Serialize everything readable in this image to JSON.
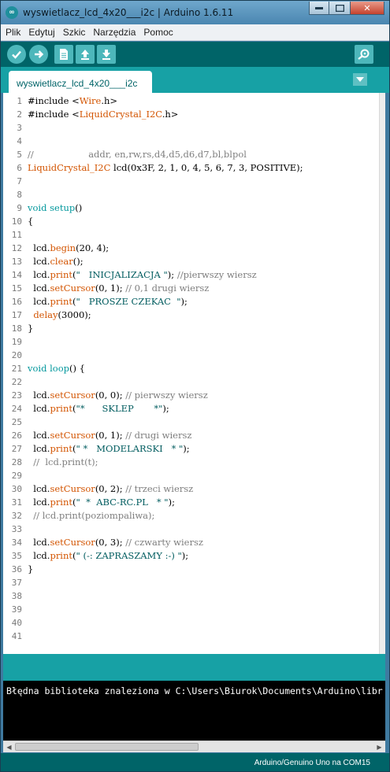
{
  "window": {
    "title": "wyswietlacz_lcd_4x20___i2c | Arduino 1.6.11",
    "app_icon": "arduino-logo-icon",
    "controls": [
      "minimize-icon",
      "maximize-icon",
      "close-icon"
    ]
  },
  "menu": [
    "Plik",
    "Edytuj",
    "Szkic",
    "Narzędzia",
    "Pomoc"
  ],
  "toolbar": {
    "buttons": [
      "verify-icon",
      "upload-icon",
      "new-file-icon",
      "open-file-icon",
      "save-file-icon"
    ],
    "right_button": "serial-monitor-icon"
  },
  "tab": {
    "label": "wyswietlacz_lcd_4x20___i2c",
    "menu_icon": "tab-dropdown-icon"
  },
  "colors": {
    "accent_dark": "#006468",
    "accent": "#17a1a5",
    "keyword": "#00979c",
    "method": "#d35400"
  },
  "code": {
    "line_numbers": [
      "1",
      "2",
      "3",
      "4",
      "5",
      "6",
      "7",
      "8",
      "9",
      "10",
      "11",
      "12",
      "13",
      "14",
      "15",
      "16",
      "17",
      "18",
      "19",
      "20",
      "21",
      "22",
      "23",
      "24",
      "25",
      "26",
      "27",
      "28",
      "29",
      "30",
      "31",
      "32",
      "33",
      "34",
      "35",
      "36",
      "37",
      "38",
      "39",
      "40",
      "41"
    ],
    "lines": [
      [
        {
          "t": "#include <",
          "c": ""
        },
        {
          "t": "Wire",
          "c": "o"
        },
        {
          "t": ".h>",
          "c": ""
        }
      ],
      [
        {
          "t": "#include <",
          "c": ""
        },
        {
          "t": "LiquidCrystal_I2C",
          "c": "o"
        },
        {
          "t": ".h>",
          "c": ""
        }
      ],
      [],
      [],
      [
        {
          "t": "//                   addr, en,rw,rs,d4,d5,d6,d7,bl,blpol",
          "c": "c"
        }
      ],
      [
        {
          "t": "LiquidCrystal_I2C",
          "c": "o"
        },
        {
          "t": " lcd(0x3F, 2, 1, 0, 4, 5, 6, 7, 3, POSITIVE);",
          "c": ""
        }
      ],
      [],
      [],
      [
        {
          "t": "void",
          "c": "k"
        },
        {
          "t": " ",
          "c": ""
        },
        {
          "t": "setup",
          "c": "k"
        },
        {
          "t": "()",
          "c": ""
        }
      ],
      [
        {
          "t": "{",
          "c": ""
        }
      ],
      [],
      [
        {
          "t": "  lcd.",
          "c": ""
        },
        {
          "t": "begin",
          "c": "o"
        },
        {
          "t": "(20, 4);",
          "c": ""
        }
      ],
      [
        {
          "t": "  lcd.",
          "c": ""
        },
        {
          "t": "clear",
          "c": "o"
        },
        {
          "t": "();",
          "c": ""
        }
      ],
      [
        {
          "t": "  lcd.",
          "c": ""
        },
        {
          "t": "print",
          "c": "o"
        },
        {
          "t": "(",
          "c": ""
        },
        {
          "t": "\"   INICJALIZACJA \"",
          "c": "s"
        },
        {
          "t": "); ",
          "c": ""
        },
        {
          "t": "//pierwszy wiersz",
          "c": "c"
        }
      ],
      [
        {
          "t": "  lcd.",
          "c": ""
        },
        {
          "t": "setCursor",
          "c": "o"
        },
        {
          "t": "(0, 1); ",
          "c": ""
        },
        {
          "t": "// 0,1 drugi wiersz",
          "c": "c"
        }
      ],
      [
        {
          "t": "  lcd.",
          "c": ""
        },
        {
          "t": "print",
          "c": "o"
        },
        {
          "t": "(",
          "c": ""
        },
        {
          "t": "\"   PROSZE CZEKAC  \"",
          "c": "s"
        },
        {
          "t": ");",
          "c": ""
        }
      ],
      [
        {
          "t": "  ",
          "c": ""
        },
        {
          "t": "delay",
          "c": "o"
        },
        {
          "t": "(3000);",
          "c": ""
        }
      ],
      [
        {
          "t": "}",
          "c": ""
        }
      ],
      [],
      [],
      [
        {
          "t": "void",
          "c": "k"
        },
        {
          "t": " ",
          "c": ""
        },
        {
          "t": "loop",
          "c": "k"
        },
        {
          "t": "() {",
          "c": ""
        }
      ],
      [],
      [
        {
          "t": "  lcd.",
          "c": ""
        },
        {
          "t": "setCursor",
          "c": "o"
        },
        {
          "t": "(0, 0); ",
          "c": ""
        },
        {
          "t": "// pierwszy wiersz",
          "c": "c"
        }
      ],
      [
        {
          "t": "  lcd.",
          "c": ""
        },
        {
          "t": "print",
          "c": "o"
        },
        {
          "t": "(",
          "c": ""
        },
        {
          "t": "\"*      SKLEP       *\"",
          "c": "s"
        },
        {
          "t": ");",
          "c": ""
        }
      ],
      [],
      [
        {
          "t": "  lcd.",
          "c": ""
        },
        {
          "t": "setCursor",
          "c": "o"
        },
        {
          "t": "(0, 1); ",
          "c": ""
        },
        {
          "t": "// drugi wiersz",
          "c": "c"
        }
      ],
      [
        {
          "t": "  lcd.",
          "c": ""
        },
        {
          "t": "print",
          "c": "o"
        },
        {
          "t": "(",
          "c": ""
        },
        {
          "t": "\" *   MODELARSKI   * \"",
          "c": "s"
        },
        {
          "t": ");",
          "c": ""
        }
      ],
      [
        {
          "t": "  //  lcd.print(t);",
          "c": "c"
        }
      ],
      [],
      [
        {
          "t": "  lcd.",
          "c": ""
        },
        {
          "t": "setCursor",
          "c": "o"
        },
        {
          "t": "(0, 2); ",
          "c": ""
        },
        {
          "t": "// trzeci wiersz",
          "c": "c"
        }
      ],
      [
        {
          "t": "  lcd.",
          "c": ""
        },
        {
          "t": "print",
          "c": "o"
        },
        {
          "t": "(",
          "c": ""
        },
        {
          "t": "\"  *  ABC-RC.PL   * \"",
          "c": "s"
        },
        {
          "t": ");",
          "c": ""
        }
      ],
      [
        {
          "t": "  // lcd.print(poziompaliwa);",
          "c": "c"
        }
      ],
      [],
      [
        {
          "t": "  lcd.",
          "c": ""
        },
        {
          "t": "setCursor",
          "c": "o"
        },
        {
          "t": "(0, 3); ",
          "c": ""
        },
        {
          "t": "// czwarty wiersz",
          "c": "c"
        }
      ],
      [
        {
          "t": "  lcd.",
          "c": ""
        },
        {
          "t": "print",
          "c": "o"
        },
        {
          "t": "(",
          "c": ""
        },
        {
          "t": "\" (-: ZAPRASZAMY :-) \"",
          "c": "s"
        },
        {
          "t": ");",
          "c": ""
        }
      ],
      [
        {
          "t": "}",
          "c": ""
        }
      ],
      [],
      [],
      [],
      [],
      []
    ]
  },
  "console": {
    "message": "Błędna biblioteka znaleziona w C:\\Users\\Biurok\\Documents\\Arduino\\libr"
  },
  "footer": {
    "board": "Arduino/Genuino Uno na COM15"
  }
}
